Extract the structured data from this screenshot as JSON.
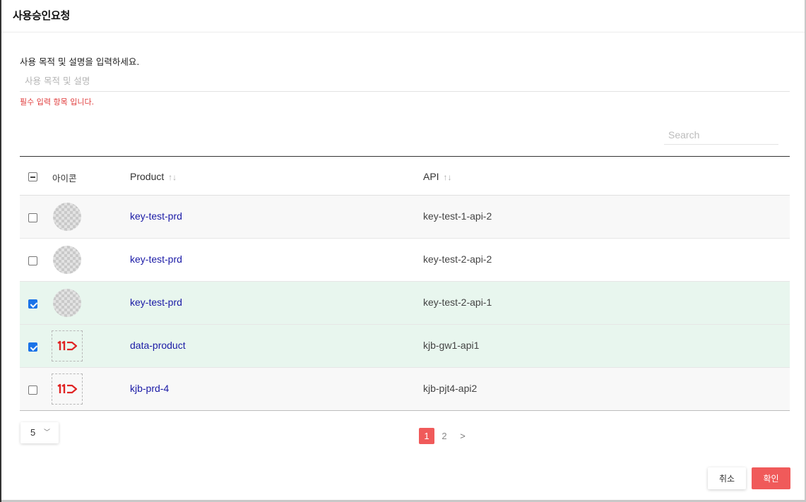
{
  "modal": {
    "title": "사용승인요청",
    "purpose_label": "사용 목적 및 설명을 입력하세요.",
    "purpose_value": "",
    "purpose_placeholder": "사용 목적 및 설명",
    "error_text": "필수 입력 항목 입니다."
  },
  "search": {
    "value": "",
    "placeholder": "Search"
  },
  "table": {
    "header_select_state": "indeterminate",
    "columns": {
      "icon": "아이콘",
      "product": "Product",
      "api": "API",
      "sort_glyph": "↑↓"
    },
    "rows": [
      {
        "icon": "placeholder-avatar",
        "product": "key-test-prd",
        "api": "key-test-1-api-2",
        "checked": false
      },
      {
        "icon": "placeholder-avatar",
        "product": "key-test-prd",
        "api": "key-test-2-api-2",
        "checked": false
      },
      {
        "icon": "placeholder-avatar",
        "product": "key-test-prd",
        "api": "key-test-2-api-1",
        "checked": true
      },
      {
        "icon": "11st-logo",
        "product": "data-product",
        "api": "kjb-gw1-api1",
        "checked": true
      },
      {
        "icon": "11st-logo",
        "product": "kjb-prd-4",
        "api": "kjb-pjt4-api2",
        "checked": false
      }
    ]
  },
  "pagination": {
    "page_size": "5",
    "pages": [
      "1",
      "2"
    ],
    "current_page": "1",
    "next": ">"
  },
  "buttons": {
    "cancel": "취소",
    "confirm": "확인"
  },
  "colors": {
    "accent": "#f05a5a",
    "link": "#1a1aa6",
    "selected_row": "#e8f6ee",
    "error": "#e03b3b",
    "logo_red": "#e02424"
  }
}
